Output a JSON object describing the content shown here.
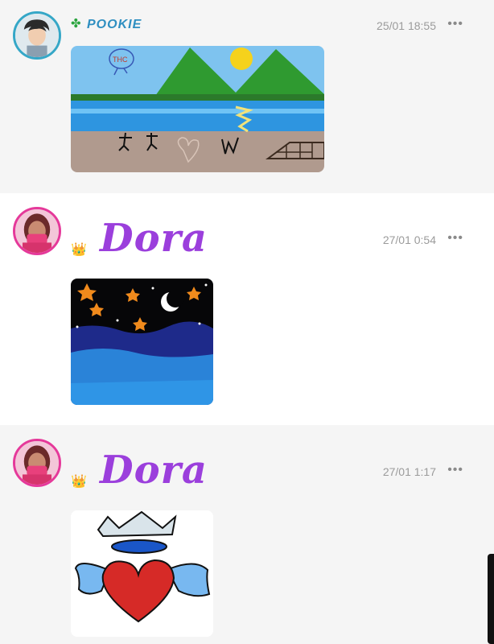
{
  "posts": [
    {
      "username": "POOKIE",
      "timestamp": "25/01 18:55",
      "more": "•••",
      "badge_icon": "clover-icon",
      "image_text": "THC"
    },
    {
      "username": "Dora",
      "timestamp": "27/01 0:54",
      "more": "•••",
      "badge_icon": "crown-icon",
      "badge": "👑"
    },
    {
      "username": "Dora",
      "timestamp": "27/01 1:17",
      "more": "•••",
      "badge_icon": "crown-icon",
      "badge": "👑"
    }
  ],
  "colors": {
    "accent_blue": "#35a7c7",
    "accent_pink": "#e5399a",
    "name_purple": "#9b3fdc"
  }
}
